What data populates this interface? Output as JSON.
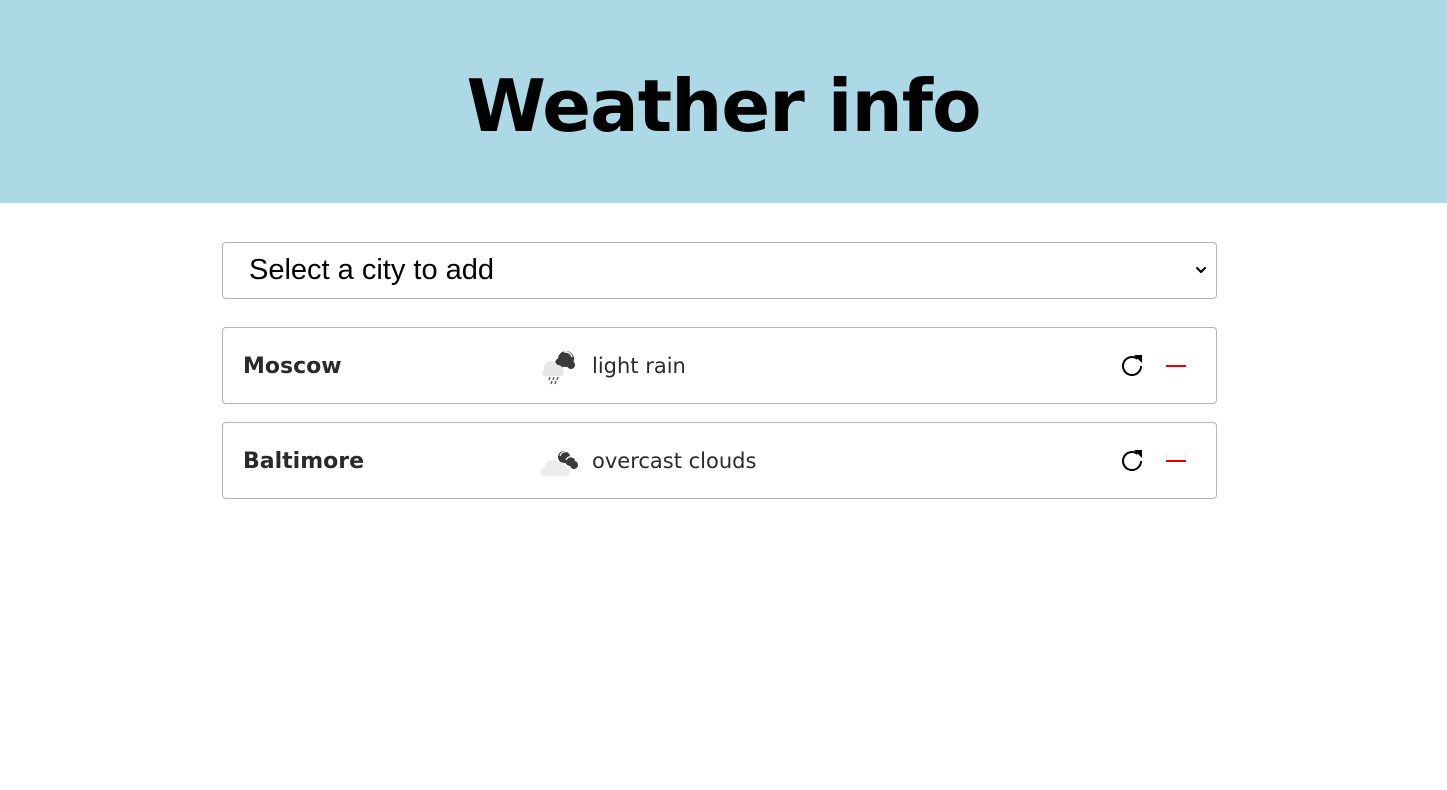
{
  "header": {
    "title": "Weather info",
    "background_color": "#add8e6"
  },
  "city_select": {
    "selected_label": "Select a city to add",
    "icon": "chevron-down-icon"
  },
  "cities": [
    {
      "name": "Moscow",
      "weather_icon": "light-rain-icon",
      "description": "light rain",
      "refresh_icon": "refresh-icon",
      "remove_icon": "minus-icon"
    },
    {
      "name": "Baltimore",
      "weather_icon": "overcast-clouds-icon",
      "description": "overcast clouds",
      "refresh_icon": "refresh-icon",
      "remove_icon": "minus-icon"
    }
  ],
  "colors": {
    "remove": "#e00000",
    "border": "#b5b5b5"
  }
}
